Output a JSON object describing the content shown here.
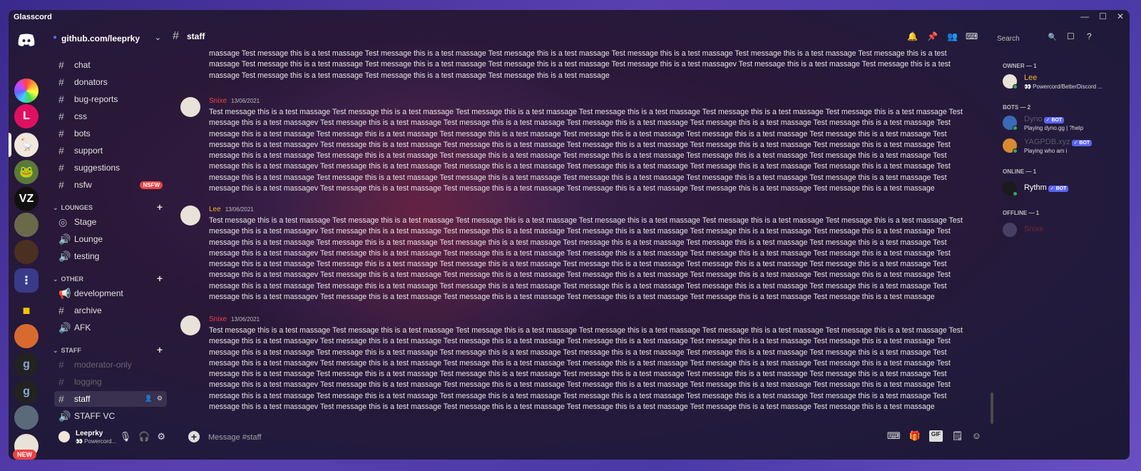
{
  "app": {
    "title": "Glasscord"
  },
  "guild": {
    "name": "github.com/leeprky"
  },
  "channels": [
    {
      "name": "chat",
      "type": "text"
    },
    {
      "name": "donators",
      "type": "text"
    },
    {
      "name": "bug-reports",
      "type": "text"
    },
    {
      "name": "css",
      "type": "text"
    },
    {
      "name": "bots",
      "type": "text"
    },
    {
      "name": "support",
      "type": "text"
    },
    {
      "name": "suggestions",
      "type": "text"
    },
    {
      "name": "nsfw",
      "type": "text",
      "badge": "NSFW"
    }
  ],
  "categories": {
    "lounges": {
      "name": "LOUNGES",
      "channels": [
        "Stage",
        "Lounge",
        "testing"
      ]
    },
    "other": {
      "name": "OTHER",
      "channels": [
        "development",
        "archive",
        "AFK"
      ]
    },
    "staff": {
      "name": "STAFF",
      "channels": [
        "moderator-only",
        "logging",
        "staff",
        "STAFF VC"
      ]
    }
  },
  "user": {
    "name": "Leeprky",
    "status": "👀 Powercord..."
  },
  "header": {
    "channel": "staff",
    "search_placeholder": "Search"
  },
  "messages": {
    "continuation": "massage Test message this is a test massage Test message this is a test massage Test message this is a test massage Test message this is a test massage Test message this is a test massage Test message this is a test massage Test message this is a test massage Test message this is a test massage Test message this is a test massage Test message this is a test massagev Test message this is a test massage Test message this is a test massage Test message this is a test massage Test message this is a test massage Test message this is a test massage",
    "items": [
      {
        "author": "Snixe",
        "date": "13/06/2021",
        "color": "#ed4245",
        "text": "Test message this is a test massage Test message this is a test massage Test message this is a test massage Test message this is a test massage Test message this is a test massage Test message this is a test massage Test message this is a test massagev Test message this is a test massage Test message this is a test massage Test message this is a test massage Test message this is a test massage Test message this is a test massage Test message this is a test massage Test message this is a test massage Test message this is a test massage Test message this is a test massage Test message this is a test massage Test message this is a test massage Test message this is a test massagev Test message this is a test massage Test message this is a test massage Test message this is a test massage Test message this is a test massage Test message this is a test massage Test message this is a test massage Test message this is a test massage Test message this is a test massage Test message this is a test massage Test message this is a test massage Test message this is a test massage Test message this is a test massagev Test message this is a test massage Test message this is a test massage Test message this is a test massage Test message this is a test massage Test message this is a test massage Test message this is a test massage Test message this is a test massage Test message this is a test massage Test message this is a test massage Test message this is a test massage Test message this is a test massage Test message this is a test massagev Test message this is a test massage Test message this is a test massage Test message this is a test massage Test message this is a test massage Test message this is a test massage"
      },
      {
        "author": "Lee",
        "date": "13/06/2021",
        "color": "#f0b232",
        "text": "Test message this is a test massage Test message this is a test massage Test message this is a test massage Test message this is a test massage Test message this is a test massage Test message this is a test massage Test message this is a test massagev Test message this is a test massage Test message this is a test massage Test message this is a test massage Test message this is a test massage Test message this is a test massage Test message this is a test massage Test message this is a test massage Test message this is a test massage Test message this is a test massage Test message this is a test massage Test message this is a test massage Test message this is a test massagev Test message this is a test massage Test message this is a test massage Test message this is a test massage Test message this is a test massage Test message this is a test massage Test message this is a test massage Test message this is a test massage Test message this is a test massage Test message this is a test massage Test message this is a test massage Test message this is a test massage Test message this is a test massagev Test message this is a test massage Test message this is a test massage Test message this is a test massage Test message this is a test massage Test message this is a test massage Test message this is a test massage Test message this is a test massage Test message this is a test massage Test message this is a test massage Test message this is a test massage Test message this is a test massage Test message this is a test massagev Test message this is a test massage Test message this is a test massage Test message this is a test massage Test message this is a test massage Test message this is a test massage"
      },
      {
        "author": "Snixe",
        "date": "13/06/2021",
        "color": "#ed4245",
        "text": "Test message this is a test massage Test message this is a test massage Test message this is a test massage Test message this is a test massage Test message this is a test massage Test message this is a test massage Test message this is a test massagev Test message this is a test massage Test message this is a test massage Test message this is a test massage Test message this is a test massage Test message this is a test massage Test message this is a test massage Test message this is a test massage Test message this is a test massage Test message this is a test massage Test message this is a test massage Test message this is a test massage Test message this is a test massagev Test message this is a test massage Test message this is a test massage Test message this is a test massage Test message this is a test massage Test message this is a test massage Test message this is a test massage Test message this is a test massage Test message this is a test massage Test message this is a test massage Test message this is a test massage Test message this is a test massage Test message this is a test massagev Test message this is a test massage Test message this is a test massage Test message this is a test massage Test message this is a test massage Test message this is a test massage Test message this is a test massage Test message this is a test massage Test message this is a test massage Test message this is a test massage Test message this is a test massage Test message this is a test massage Test message this is a test massagev Test message this is a test massage Test message this is a test massage Test message this is a test massage Test message this is a test massage Test message this is a test massage"
      }
    ]
  },
  "composer": {
    "placeholder": "Message #staff",
    "gif_label": "GIF"
  },
  "members": {
    "owner_header": "OWNER — 1",
    "owner": {
      "name": "Lee",
      "status": "👀 Powercord/BetterDiscord ...",
      "color": "#f0b232"
    },
    "bots_header": "BOTS — 2",
    "bots": [
      {
        "name": "Dyno",
        "status": "Playing dyno.gg | ?help",
        "tag": "✓ BOT"
      },
      {
        "name": "YAGPDB.xyz",
        "status": "Playing who am i",
        "tag": "✓ BOT"
      }
    ],
    "online_header": "ONLINE — 1",
    "online": {
      "name": "Rythm",
      "tag": "✓ BOT"
    },
    "offline_header": "OFFLINE — 1",
    "offline": {
      "name": "Snixe"
    }
  },
  "rail": {
    "new_badge": "NEW"
  }
}
